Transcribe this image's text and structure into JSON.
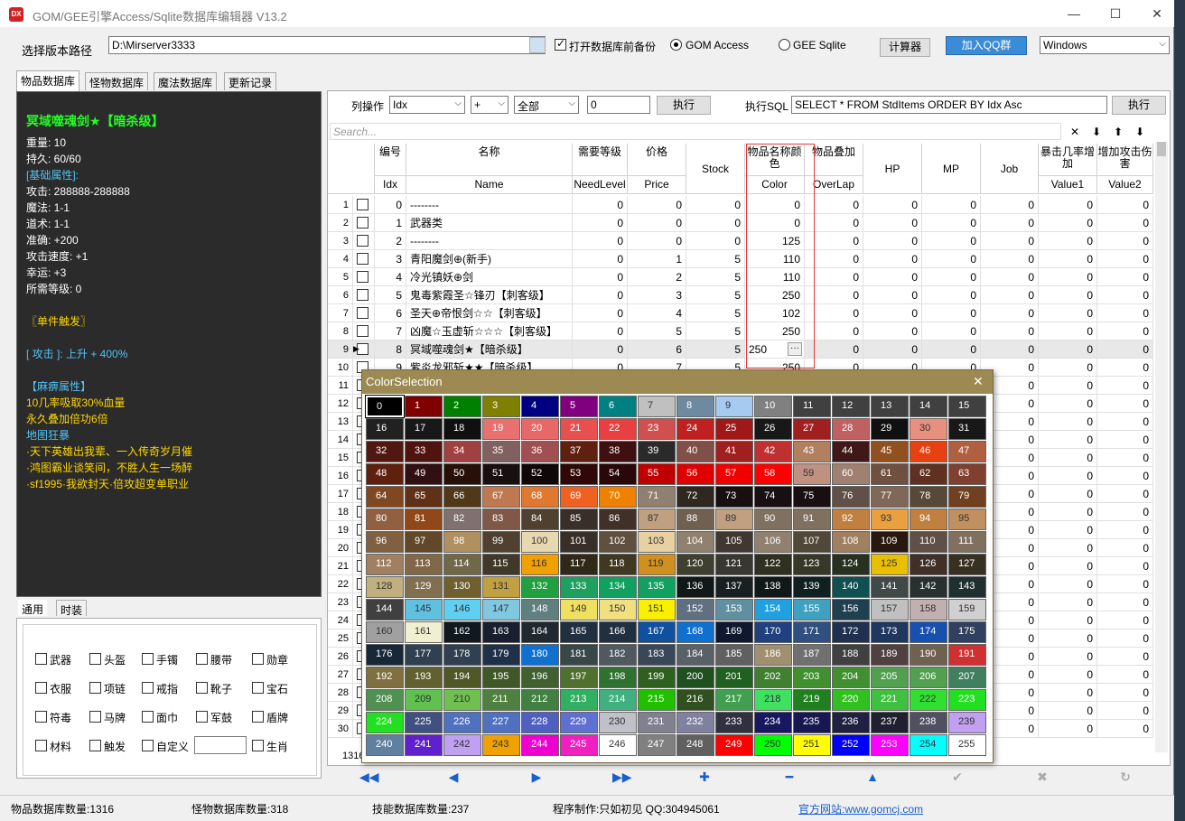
{
  "title": "GOM/GEE引擎Access/Sqlite数据库编辑器 V13.2",
  "title_icon": "DX",
  "window_controls": {
    "minimize": "—",
    "maximize": "☐",
    "close": "✕"
  },
  "top": {
    "path_label": "选择版本路径",
    "path_value": "D:\\Mirserver3333",
    "backup_label": "打开数据库前备份",
    "gom_label": "GOM Access",
    "gee_label": "GEE Sqlite",
    "calc": "计算器",
    "qq": "加入QQ群",
    "theme": "Windows"
  },
  "tabs": [
    "物品数据库",
    "怪物数据库",
    "魔法数据库",
    "更新记录"
  ],
  "info": {
    "name": "冥域噬魂剑★【暗杀级】",
    "lines": [
      {
        "t": "重量: 10",
        "c": "#ffffff"
      },
      {
        "t": "持久: 60/60",
        "c": "#ffffff"
      },
      {
        "t": "[基础属性]:",
        "c": "#4fc3f7"
      },
      {
        "t": "攻击:        288888-288888",
        "c": "#ffffff"
      },
      {
        "t": "魔法:        1-1",
        "c": "#ffffff"
      },
      {
        "t": "道术:        1-1",
        "c": "#ffffff"
      },
      {
        "t": "准确:        +200",
        "c": "#ffffff"
      },
      {
        "t": "攻击速度:    +1",
        "c": "#ffffff"
      },
      {
        "t": "幸运:        +3",
        "c": "#ffffff"
      },
      {
        "t": "所需等级: 0",
        "c": "#ffffff"
      },
      {
        "t": "",
        "c": "#ffffff"
      },
      {
        "t": "  〖单件触发〗",
        "c": "#ffd700"
      },
      {
        "t": "",
        "c": "#ffffff"
      },
      {
        "t": "[ 攻击 ]: 上升 + 400%",
        "c": "#4fc3f7"
      },
      {
        "t": "",
        "c": "#ffffff"
      },
      {
        "t": "  【麻痹属性】",
        "c": "#4fc3f7"
      },
      {
        "t": "10几率吸取30%血量",
        "c": "#ffd700"
      },
      {
        "t": " 永久叠加倍功6倍",
        "c": "#ffd700"
      },
      {
        "t": "    地图狂暴",
        "c": "#4fc3f7"
      },
      {
        "t": "·天下英雄出我辈、一入传奇岁月催",
        "c": "#ffd700"
      },
      {
        "t": "·鸿图霸业谈笑间，不胜人生一场醉",
        "c": "#ffd700"
      },
      {
        "t": "·sf1995·我欲封天·倍攻超变单职业",
        "c": "#ffd700"
      }
    ]
  },
  "cat_tabs": [
    "通用",
    "时装"
  ],
  "categories": [
    [
      "武器",
      "头盔",
      "手镯",
      "腰带",
      "勋章"
    ],
    [
      "衣服",
      "项链",
      "戒指",
      "靴子",
      "宝石"
    ],
    [
      "符毒",
      "马牌",
      "面巾",
      "军鼓",
      "盾牌"
    ],
    [
      "材料",
      "触发",
      "自定义",
      "",
      "生肖"
    ]
  ],
  "toolbar": {
    "op_label": "列操作",
    "col": "Idx",
    "op": "+",
    "scope": "全部",
    "value": "0",
    "exec": "执行",
    "sql_label": "执行SQL",
    "sql": "SELECT * FROM StdItems ORDER BY Idx Asc",
    "exec2": "执行",
    "search_ph": "Search...",
    "search_icons": [
      "✕",
      "⬇",
      "⬆",
      "⬇"
    ]
  },
  "grid": {
    "headers_cn": [
      "编号",
      "名称",
      "需要等级",
      "价格",
      "Stock",
      "物品名称颜色",
      "物品叠加",
      "HP",
      "MP",
      "Job",
      "暴击几率增加",
      "增加攻击伤害"
    ],
    "headers_en": [
      "Idx",
      "Name",
      "NeedLevel",
      "Price",
      "",
      "Color",
      "OverLap",
      "",
      "",
      "",
      "Value1",
      "Value2"
    ],
    "rows": [
      [
        "1",
        "0",
        "--------",
        "0",
        "0",
        "0",
        "0",
        "0",
        "0",
        "0",
        "0",
        "0",
        "0"
      ],
      [
        "2",
        "1",
        "武器类",
        "0",
        "0",
        "0",
        "0",
        "0",
        "0",
        "0",
        "0",
        "0",
        "0"
      ],
      [
        "3",
        "2",
        "--------",
        "0",
        "0",
        "0",
        "125",
        "0",
        "0",
        "0",
        "0",
        "0",
        "0"
      ],
      [
        "4",
        "3",
        "青阳魔剑⊕(新手)",
        "0",
        "1",
        "5",
        "110",
        "0",
        "0",
        "0",
        "0",
        "0",
        "0"
      ],
      [
        "5",
        "4",
        "冷光镇妖⊕剑",
        "0",
        "2",
        "5",
        "110",
        "0",
        "0",
        "0",
        "0",
        "0",
        "0"
      ],
      [
        "6",
        "5",
        "鬼毒紫霞圣☆锋刃【刺客级】",
        "0",
        "3",
        "5",
        "250",
        "0",
        "0",
        "0",
        "0",
        "0",
        "0"
      ],
      [
        "7",
        "6",
        "圣天⊕帝恨剑☆☆【刺客级】",
        "0",
        "4",
        "5",
        "102",
        "0",
        "0",
        "0",
        "0",
        "0",
        "0"
      ],
      [
        "8",
        "7",
        "凶魔☆玉虚斩☆☆☆【刺客级】",
        "0",
        "5",
        "5",
        "250",
        "0",
        "0",
        "0",
        "0",
        "0",
        "0"
      ],
      [
        "9",
        "8",
        "冥域噬魂剑★【暗杀级】",
        "0",
        "6",
        "5",
        "250",
        "0",
        "0",
        "0",
        "0",
        "0",
        "0"
      ],
      [
        "10",
        "9",
        "紫炎龙邪斩★★【暗杀级】",
        "0",
        "7",
        "5",
        "250",
        "0",
        "0",
        "0",
        "0",
        "0",
        "0"
      ],
      [
        "11",
        "",
        "",
        "",
        "",
        "",
        "",
        "",
        "",
        "",
        "0",
        "0",
        "0"
      ],
      [
        "12",
        "",
        "",
        "",
        "",
        "",
        "",
        "",
        "",
        "",
        "0",
        "0",
        "0"
      ],
      [
        "13",
        "",
        "",
        "",
        "",
        "",
        "",
        "",
        "",
        "",
        "0",
        "0",
        "0"
      ],
      [
        "14",
        "",
        "",
        "",
        "",
        "",
        "",
        "",
        "",
        "",
        "0",
        "0",
        "0"
      ],
      [
        "15",
        "",
        "",
        "",
        "",
        "",
        "",
        "",
        "",
        "",
        "0",
        "0",
        "0"
      ],
      [
        "16",
        "",
        "",
        "",
        "",
        "",
        "",
        "",
        "",
        "",
        "0",
        "0",
        "0"
      ],
      [
        "17",
        "",
        "",
        "",
        "",
        "",
        "",
        "",
        "",
        "",
        "0",
        "0",
        "0"
      ],
      [
        "18",
        "",
        "",
        "",
        "",
        "",
        "",
        "",
        "",
        "",
        "0",
        "0",
        "0"
      ],
      [
        "19",
        "",
        "",
        "",
        "",
        "",
        "",
        "",
        "",
        "",
        "0",
        "0",
        "0"
      ],
      [
        "20",
        "",
        "",
        "",
        "",
        "",
        "",
        "",
        "",
        "",
        "0",
        "0",
        "0"
      ],
      [
        "21",
        "",
        "",
        "",
        "",
        "",
        "",
        "",
        "",
        "",
        "0",
        "0",
        "0"
      ],
      [
        "22",
        "",
        "",
        "",
        "",
        "",
        "",
        "",
        "",
        "",
        "0",
        "0",
        "0"
      ],
      [
        "23",
        "",
        "",
        "",
        "",
        "",
        "",
        "",
        "",
        "",
        "0",
        "0",
        "0"
      ],
      [
        "24",
        "",
        "",
        "",
        "",
        "",
        "",
        "",
        "",
        "",
        "0",
        "0",
        "0"
      ],
      [
        "25",
        "",
        "",
        "",
        "",
        "",
        "",
        "",
        "",
        "",
        "0",
        "0",
        "0"
      ],
      [
        "26",
        "",
        "",
        "",
        "",
        "",
        "",
        "",
        "",
        "",
        "0",
        "0",
        "0"
      ],
      [
        "27",
        "",
        "",
        "",
        "",
        "",
        "",
        "",
        "",
        "",
        "0",
        "0",
        "0"
      ],
      [
        "28",
        "",
        "",
        "",
        "",
        "",
        "",
        "",
        "",
        "",
        "0",
        "0",
        "0"
      ],
      [
        "29",
        "",
        "",
        "",
        "",
        "",
        "",
        "",
        "",
        "",
        "0",
        "0",
        "0"
      ],
      [
        "30",
        "",
        "",
        "",
        "",
        "",
        "",
        "",
        "",
        "",
        "0",
        "0",
        "0"
      ]
    ],
    "footer_count": "1316",
    "edit_value": "250",
    "edit_btn": "···"
  },
  "nav": [
    "◀◀",
    "◀",
    "▶",
    "▶▶",
    "✚",
    "━",
    "▲",
    "✔",
    "✖",
    "↻"
  ],
  "status": {
    "items": "物品数据库数量:1316",
    "monsters": "怪物数据库数量:318",
    "skills": "技能数据库数量:237",
    "author": "程序制作:只如初见 QQ:304945061",
    "site": "官方网站:www.gomcj.com"
  },
  "color_dialog": {
    "title": "ColorSelection",
    "close": "✕",
    "colors": [
      "#000000",
      "#800000",
      "#008000",
      "#808000",
      "#000080",
      "#800080",
      "#008080",
      "#c0c0c0",
      "#6e8aa0",
      "#a6caf0",
      "#808080",
      "#404040",
      "#404040",
      "#404040",
      "#404040",
      "#404040",
      "#212121",
      "#181818",
      "#101010",
      "#e87070",
      "#e86868",
      "#e85050",
      "#e84040",
      "#d05050",
      "#c02020",
      "#a01818",
      "#181818",
      "#a02020",
      "#c06060",
      "#101010",
      "#e89080",
      "#181818",
      "#501810",
      "#501410",
      "#a04040",
      "#806060",
      "#a05050",
      "#602010",
      "#401010",
      "#2a2a2a",
      "#805048",
      "#a02020",
      "#c03030",
      "#b08060",
      "#401818",
      "#905020",
      "#e84010",
      "#b06040",
      "#602010",
      "#301010",
      "#281008",
      "#181010",
      "#100808",
      "#300808",
      "#280808",
      "#c00000",
      "#e00000",
      "#f00000",
      "#ff0000",
      "#c09080",
      "#a08070",
      "#705040",
      "#603020",
      "#804030",
      "#804820",
      "#603018",
      "#503818",
      "#c07850",
      "#e07830",
      "#f06020",
      "#f08000",
      "#908070",
      "#302820",
      "#181010",
      "#181010",
      "#181010",
      "#605048",
      "#806858",
      "#584838",
      "#704020",
      "#906040",
      "#904818",
      "#807070",
      "#805848",
      "#504030",
      "#383028",
      "#403028",
      "#c0a080",
      "#706050",
      "#c0a080",
      "#807060",
      "#807060",
      "#c08040",
      "#e8a040",
      "#c08040",
      "#c09060",
      "#806040",
      "#604828",
      "#b09060",
      "#504030",
      "#e8d8b0",
      "#383028",
      "#605040",
      "#e8d0a0",
      "#908070",
      "#403830",
      "#908070",
      "#504838",
      "#a08060",
      "#281810",
      "#605048",
      "#807060",
      "#a08060",
      "#806848",
      "#706848",
      "#403828",
      "#f0a000",
      "#302818",
      "#403820",
      "#d09020",
      "#404030",
      "#383830",
      "#303020",
      "#383828",
      "#283020",
      "#e8c000",
      "#403028",
      "#383020",
      "#c0b080",
      "#807050",
      "#706030",
      "#c0a040",
      "#20a040",
      "#20a060",
      "#10a060",
      "#10a060",
      "#101818",
      "#182020",
      "#101818",
      "#102020",
      "#105050",
      "#404848",
      "#283030",
      "#203030",
      "#404040",
      "#60c0e0",
      "#60d0f0",
      "#80c8e0",
      "#608080",
      "#f0e060",
      "#f0e080",
      "#f8f000",
      "#607080",
      "#6090a0",
      "#20a0e0",
      "#40a0c0",
      "#204050",
      "#c0c0c0",
      "#c0b0b0",
      "#d0d0d0",
      "#a0a0a0",
      "#f0f0d0",
      "#101820",
      "#182030",
      "#202830",
      "#203040",
      "#203040",
      "#1050a0",
      "#1070d0",
      "#101830",
      "#204080",
      "#305080",
      "#203050",
      "#203860",
      "#1850b0",
      "#304060",
      "#182838",
      "#304050",
      "#304050",
      "#203048",
      "#1070d0",
      "#384848",
      "#505860",
      "#384858",
      "#586068",
      "#606060",
      "#a09070",
      "#707070",
      "#404040",
      "#504040",
      "#706050",
      "#d03030",
      "#807040",
      "#606030",
      "#505828",
      "#405828",
      "#406030",
      "#507030",
      "#307030",
      "#306020",
      "#205020",
      "#206020",
      "#408030",
      "#409030",
      "#409030",
      "#50a050",
      "#50a050",
      "#408060",
      "#509050",
      "#60c050",
      "#70c050",
      "#508040",
      "#408040",
      "#30b060",
      "#40b080",
      "#20c000",
      "#305020",
      "#40a050",
      "#40e060",
      "#208020",
      "#30c020",
      "#40c040",
      "#30e030",
      "#20e020",
      "#20e020",
      "#405080",
      "#5070c0",
      "#5070c0",
      "#5060c0",
      "#6070d0",
      "#c0c0c8",
      "#808090",
      "#8080a0",
      "#303040",
      "#181860",
      "#181850",
      "#202040",
      "#202030",
      "#505060",
      "#c0a0f0",
      "#6080a0",
      "#6020d0",
      "#c0a0f0",
      "#f0a000",
      "#f000d0",
      "#f020c0",
      "#ffffff",
      "#808080",
      "#606060",
      "#ff0000",
      "#00ff00",
      "#ffff00",
      "#0000ff",
      "#ff00ff",
      "#00ffff",
      "#ffffff"
    ]
  }
}
